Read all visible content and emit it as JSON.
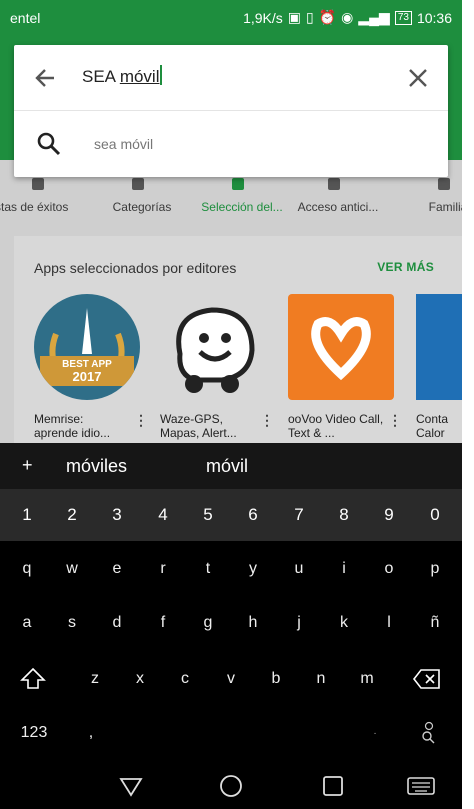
{
  "status_bar": {
    "carrier": "entel",
    "speed": "1,9K/s",
    "battery": "73",
    "time": "10:36"
  },
  "search": {
    "query_prefix": "SEA ",
    "query_word": "móvil",
    "suggestion": "sea móvil"
  },
  "tabs": [
    {
      "label": "Listas de éxitos"
    },
    {
      "label": "Categorías"
    },
    {
      "label": "Selección del..."
    },
    {
      "label": "Acceso antici..."
    },
    {
      "label": "Familia"
    }
  ],
  "editors_card": {
    "title": "Apps seleccionados por editores",
    "more": "VER MÁS",
    "apps": [
      {
        "name": "Memrise: aprende idio...",
        "badge_top": "BEST APP",
        "badge_year": "2017"
      },
      {
        "name": "Waze-GPS, Mapas, Alert..."
      },
      {
        "name": "ooVoo Video Call, Text & ..."
      },
      {
        "name": "Conta Calor"
      }
    ]
  },
  "keyboard": {
    "plus": "+",
    "suggestions": [
      "móviles",
      "móvil"
    ],
    "numbers": [
      "1",
      "2",
      "3",
      "4",
      "5",
      "6",
      "7",
      "8",
      "9",
      "0"
    ],
    "row1": [
      "q",
      "w",
      "e",
      "r",
      "t",
      "y",
      "u",
      "i",
      "o",
      "p"
    ],
    "row2": [
      "a",
      "s",
      "d",
      "f",
      "g",
      "h",
      "j",
      "k",
      "l",
      "ñ"
    ],
    "row3": [
      "z",
      "x",
      "c",
      "v",
      "b",
      "n",
      "m"
    ],
    "mode_key": "123",
    "comma": ","
  },
  "colors": {
    "accent": "#1e8e3e",
    "keyboard_bg": "#000000"
  }
}
